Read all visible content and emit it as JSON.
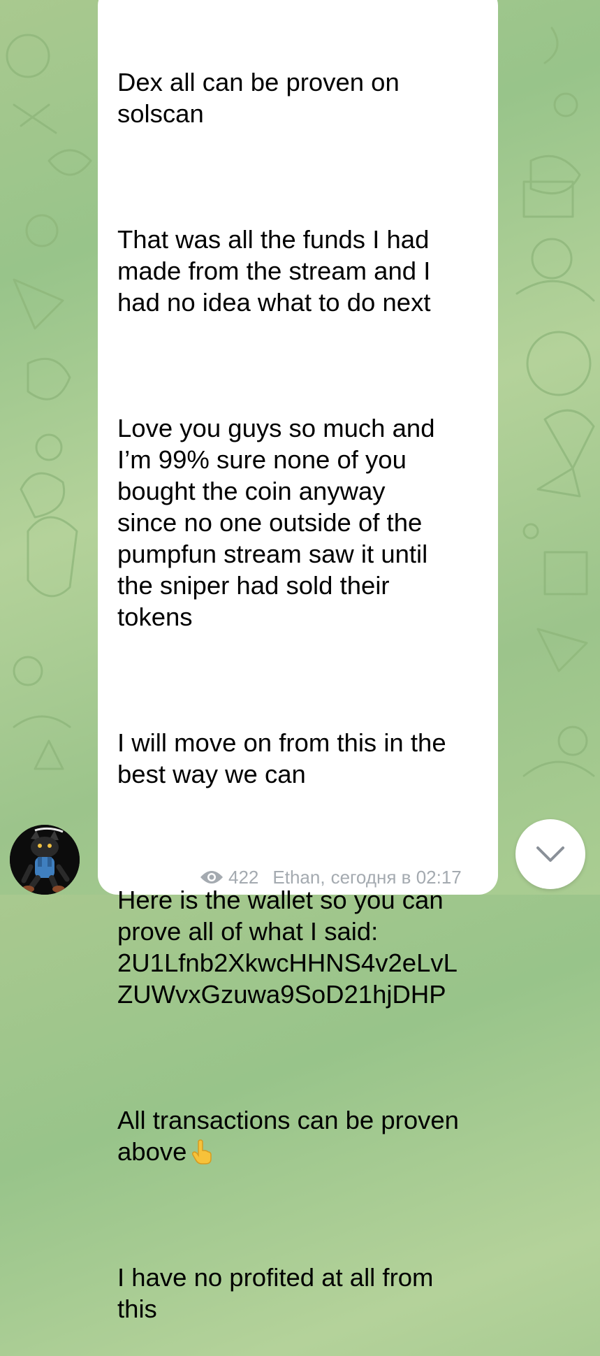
{
  "message": {
    "paragraphs": [
      "Dex all can be proven on\nsolscan",
      "That was all the funds I had\nmade from the stream and I\nhad no idea what to do next",
      "Love you guys so much and\nI’m 99% sure none of you\nbought the coin anyway\nsince no one outside of the\npumpfun stream saw it until\nthe sniper had sold their\ntokens",
      "I will move on from this in the\nbest way we can",
      "Here is the wallet so you can\nprove all of what I said:\n2U1Lfnb2XkwcHHNS4v2eLvL\nZUWvxGzuwa9SoD21hjDHP",
      "All transactions can be proven\nabove",
      "I have no profited at all from\nthis"
    ],
    "emoji_icon": "pointing-up-emoji"
  },
  "meta": {
    "views": "422",
    "author": "Ethan,",
    "time": "сегодня в 02:17",
    "eye_icon": "eye-icon"
  },
  "avatar": {
    "icon": "cat-character-avatar"
  },
  "scroll_button": {
    "icon": "chevron-down-icon"
  },
  "colors": {
    "bubble": "#ffffff",
    "meta_text": "#a4aab0",
    "wallpaper": "#a9c98f"
  }
}
